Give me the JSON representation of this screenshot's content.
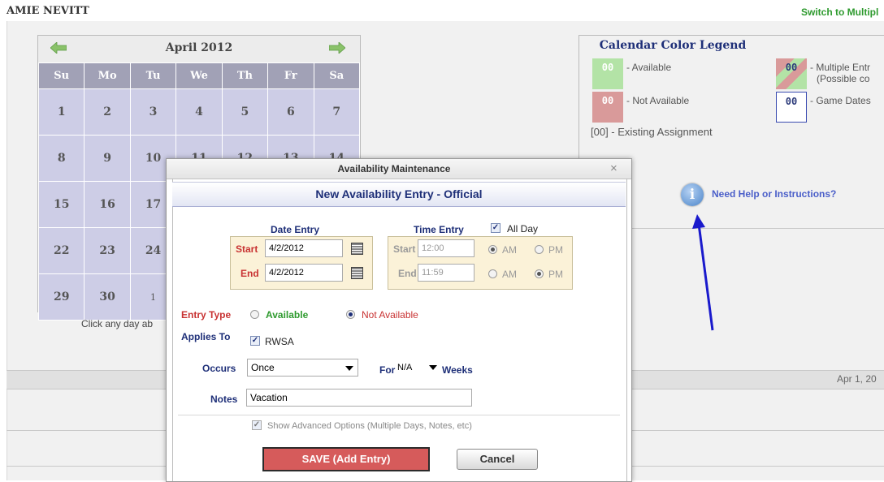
{
  "header": {
    "user_name": "AMIE NEVITT",
    "switch_link": "Switch to Multipl"
  },
  "calendar": {
    "month_label": "April 2012",
    "weekdays": [
      "Su",
      "Mo",
      "Tu",
      "We",
      "Th",
      "Fr",
      "Sa"
    ],
    "weeks": [
      [
        "1",
        "2",
        "3",
        "4",
        "5",
        "6",
        "7"
      ],
      [
        "8",
        "9",
        "10",
        "11",
        "12",
        "13",
        "14"
      ],
      [
        "15",
        "16",
        "17"
      ],
      [
        "22",
        "23",
        "24"
      ],
      [
        "29",
        "30",
        "1"
      ]
    ],
    "hint": "Click any day ab"
  },
  "legend": {
    "title": "Calendar Color Legend",
    "items": {
      "available": {
        "swatch": "00",
        "label": "- Available",
        "color": "#b3e3a6"
      },
      "not_available": {
        "swatch": "00",
        "label": "- Not Available",
        "color": "#d99a9a"
      },
      "existing": {
        "label": "[00] - Existing Assignment"
      },
      "multiple": {
        "swatch": "00",
        "label_1": "- Multiple Entr",
        "label_2": "(Possible co"
      },
      "game_dates": {
        "swatch": "00",
        "label": "- Game Dates"
      }
    }
  },
  "help": {
    "icon_glyph": "i",
    "link": "Need Help or Instructions?"
  },
  "bottom_bar": {
    "date": "Apr 1, 20"
  },
  "dialog": {
    "title": "Availability Maintenance",
    "close_glyph": "×",
    "subtitle": "New Availability Entry - Official",
    "date_entry": {
      "title": "Date Entry",
      "start_label": "Start",
      "start_value": "4/2/2012",
      "end_label": "End",
      "end_value": "4/2/2012"
    },
    "time_entry": {
      "title": "Time Entry",
      "all_day_label": "All Day",
      "all_day_checked": true,
      "start_label": "Start",
      "start_value": "12:00",
      "end_label": "End",
      "end_value": "11:59",
      "am": "AM",
      "pm": "PM"
    },
    "entry_type": {
      "label": "Entry Type",
      "available": "Available",
      "not_available": "Not Available",
      "selected": "Not Available"
    },
    "applies_to": {
      "label": "Applies To",
      "option": "RWSA"
    },
    "occurs": {
      "label": "Occurs",
      "value": "Once",
      "for_label": "For",
      "for_value": "N/A",
      "weeks_label": "Weeks"
    },
    "notes": {
      "label": "Notes",
      "value": "Vacation"
    },
    "advanced": {
      "label": "Show Advanced Options (Multiple Days, Notes, etc)",
      "checked": true
    },
    "buttons": {
      "save": "SAVE (Add Entry)",
      "cancel": "Cancel"
    }
  },
  "colors": {
    "navy": "#1e2f78",
    "red": "#c83232",
    "green": "#2e9a2e",
    "cal_header": "#a1a1b6",
    "cal_cell": "#cdcde6",
    "annotation_arrow": "#1a1acc"
  }
}
